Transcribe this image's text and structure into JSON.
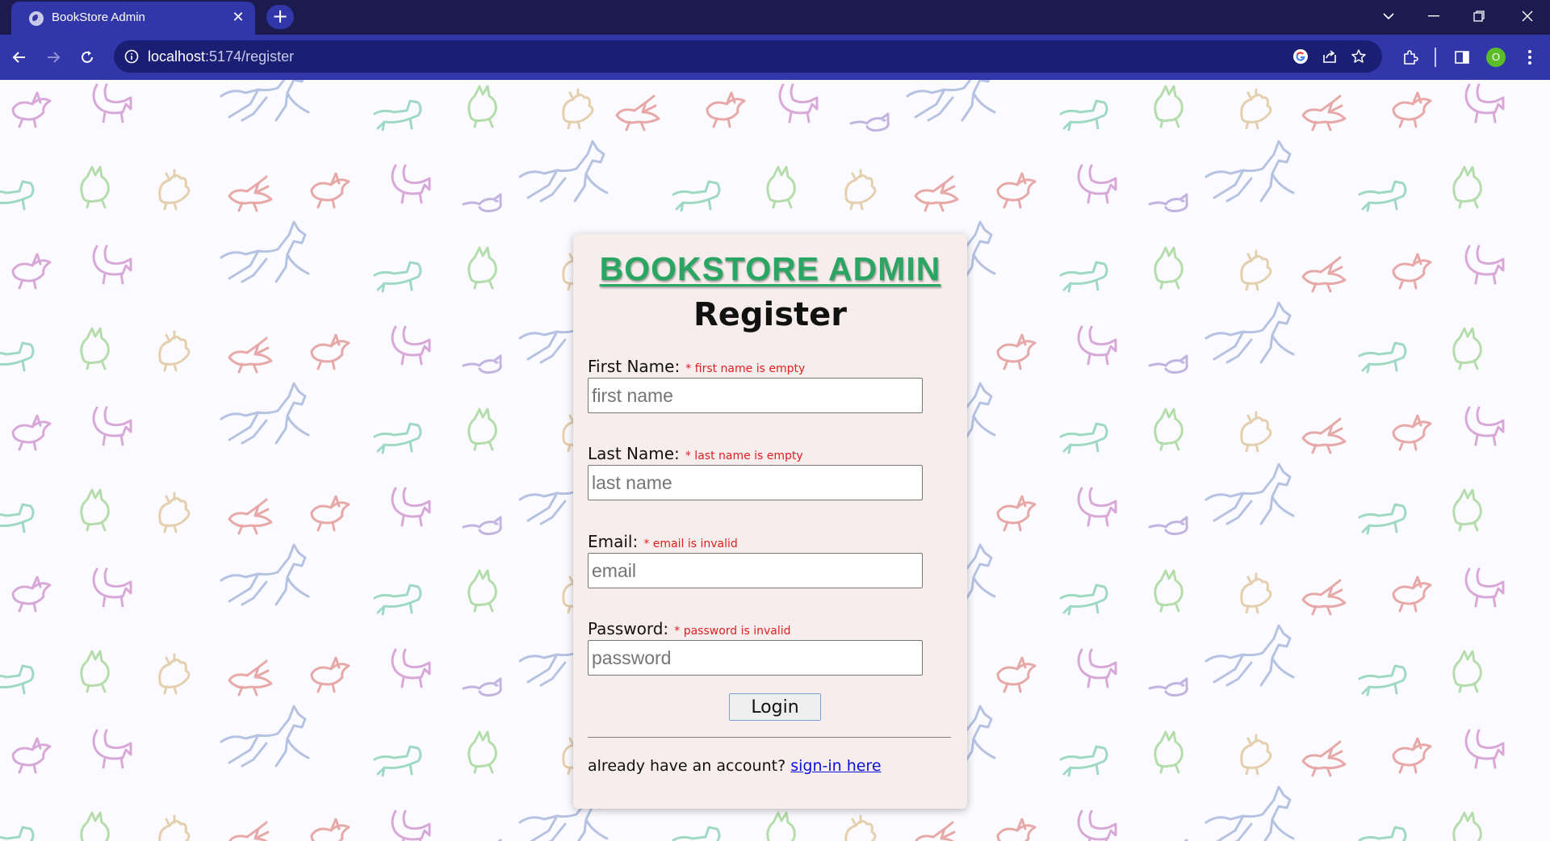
{
  "browser": {
    "tab_title": "BookStore Admin",
    "tab_close": "✕",
    "new_tab": "+",
    "url_host": "localhost",
    "url_path": ":5174/register",
    "profile_initial": "O"
  },
  "colors": {
    "titlebar": "#1b1b4f",
    "toolbar": "#3136a8",
    "brand_green": "#2aa562",
    "error_red": "#e01f1f",
    "link_blue": "#0b12d8",
    "card_bg": "#f7eded"
  },
  "page": {
    "brand": "BOOKSTORE ADMIN",
    "heading": "Register",
    "fields": {
      "first_name": {
        "label": "First Name:",
        "error": "* first name is empty",
        "placeholder": "first name",
        "value": ""
      },
      "last_name": {
        "label": "Last Name:",
        "error": "* last name is empty",
        "placeholder": "last name",
        "value": ""
      },
      "email": {
        "label": "Email:",
        "error": "* email is invalid",
        "placeholder": "email",
        "value": ""
      },
      "password": {
        "label": "Password:",
        "error": "* password is invalid",
        "placeholder": "password",
        "value": ""
      }
    },
    "submit_label": "Login",
    "signin_prompt": "already have an account?",
    "signin_link": "sign-in here"
  },
  "icons": [
    "globe-icon",
    "close-icon",
    "plus-icon",
    "chevron-down-icon",
    "minimize-icon",
    "restore-icon",
    "window-close-icon",
    "back-arrow-icon",
    "forward-arrow-icon",
    "reload-icon",
    "info-icon",
    "google-icon",
    "share-icon",
    "star-icon",
    "extensions-icon",
    "side-panel-icon",
    "kebab-menu-icon"
  ]
}
